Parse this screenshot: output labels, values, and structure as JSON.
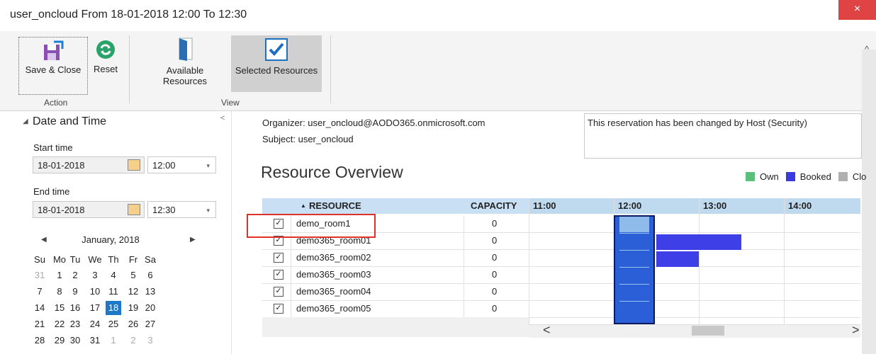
{
  "window": {
    "title": "user_oncloud From 18-01-2018 12:00 To 12:30",
    "close": "×"
  },
  "ribbon": {
    "save_close": "Save & Close",
    "reset": "Reset",
    "action_group": "Action",
    "available_resources_line1": "Available",
    "available_resources_line2": "Resources",
    "selected_resources": "Selected Resources",
    "view_group": "View"
  },
  "left": {
    "section_title": "Date and Time",
    "start_label": "Start time",
    "start_date": "18-01-2018",
    "start_time": "12:00",
    "end_label": "End time",
    "end_date": "18-01-2018",
    "end_time": "12:30",
    "calendar": {
      "month": "January, 2018",
      "weekdays": [
        "Su",
        "Mo",
        "Tu",
        "We",
        "Th",
        "Fr",
        "Sa"
      ],
      "weeks": [
        [
          "31",
          "1",
          "2",
          "3",
          "4",
          "5",
          "6"
        ],
        [
          "7",
          "8",
          "9",
          "10",
          "11",
          "12",
          "13"
        ],
        [
          "14",
          "15",
          "16",
          "17",
          "18",
          "19",
          "20"
        ],
        [
          "21",
          "22",
          "23",
          "24",
          "25",
          "26",
          "27"
        ],
        [
          "28",
          "29",
          "30",
          "31",
          "1",
          "2",
          "3"
        ]
      ],
      "selected": "18"
    }
  },
  "details": {
    "organizer": "Organizer: user_oncloud@AODO365.onmicrosoft.com",
    "subject": "Subject: user_oncloud",
    "note": "This reservation has been changed by Host (Security)"
  },
  "overview": {
    "title": "Resource Overview",
    "legend": [
      {
        "label": "Own",
        "color": "#5cc07a"
      },
      {
        "label": "Booked",
        "color": "#3a3ae0"
      },
      {
        "label": "Clo",
        "color": "#b0b0b0"
      }
    ],
    "columns": {
      "resource": "RESOURCE",
      "capacity": "CAPACITY",
      "times": [
        "11:00",
        "12:00",
        "13:00",
        "14:00"
      ]
    },
    "rows": [
      {
        "name": "demo_room1",
        "capacity": "0"
      },
      {
        "name": "demo365_room01",
        "capacity": "0"
      },
      {
        "name": "demo365_room02",
        "capacity": "0"
      },
      {
        "name": "demo365_room03",
        "capacity": "0"
      },
      {
        "name": "demo365_room04",
        "capacity": "0"
      },
      {
        "name": "demo365_room05",
        "capacity": "0"
      }
    ],
    "scroll_left": "<",
    "scroll_right": ">"
  }
}
